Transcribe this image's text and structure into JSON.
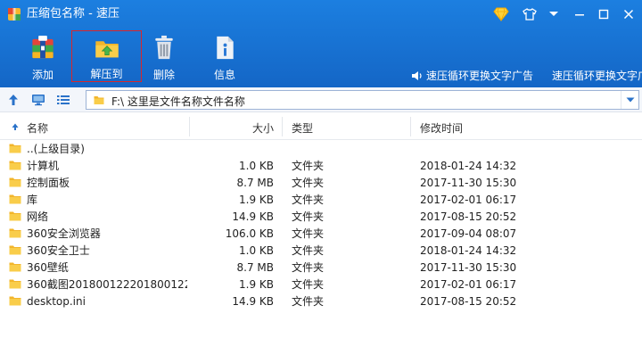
{
  "window": {
    "title": "压缩包名称 - 速压",
    "brand_color": "#1670d4"
  },
  "toolbar": {
    "buttons": [
      {
        "label": "添加",
        "icon": "add-archive-icon"
      },
      {
        "label": "解压到",
        "icon": "extract-folder-icon",
        "selected": true
      },
      {
        "label": "删除",
        "icon": "trash-icon"
      },
      {
        "label": "信息",
        "icon": "info-document-icon"
      }
    ],
    "ads": [
      {
        "text": "速压循环更换文字广告",
        "icon": "speaker-icon"
      },
      {
        "text": "速压循环更换文字广告"
      }
    ]
  },
  "address": {
    "path": "F:\\ 这里是文件名称文件名称"
  },
  "columns": {
    "name": "名称",
    "size": "大小",
    "type": "类型",
    "modified": "修改时间"
  },
  "files": [
    {
      "name": "..(上级目录)",
      "size": "",
      "type": "",
      "modified": ""
    },
    {
      "name": "计算机",
      "size": "1.0 KB",
      "type": "文件夹",
      "modified": "2018-01-24 14:32"
    },
    {
      "name": "控制面板",
      "size": "8.7 MB",
      "type": "文件夹",
      "modified": "2017-11-30 15:30"
    },
    {
      "name": "库",
      "size": "1.9 KB",
      "type": "文件夹",
      "modified": "2017-02-01 06:17"
    },
    {
      "name": "网络",
      "size": "14.9 KB",
      "type": "文件夹",
      "modified": "2017-08-15 20:52"
    },
    {
      "name": "360安全浏览器",
      "size": "106.0 KB",
      "type": "文件夹",
      "modified": "2017-09-04 08:07"
    },
    {
      "name": "360安全卫士",
      "size": "1.0 KB",
      "type": "文件夹",
      "modified": "2018-01-24 14:32"
    },
    {
      "name": "360壁纸",
      "size": "8.7 MB",
      "type": "文件夹",
      "modified": "2017-11-30 15:30"
    },
    {
      "name": "360截图201800122201800122...",
      "size": "1.9 KB",
      "type": "文件夹",
      "modified": "2017-02-01 06:17"
    },
    {
      "name": "desktop.ini",
      "size": "14.9 KB",
      "type": "文件夹",
      "modified": "2017-08-15 20:52"
    }
  ]
}
